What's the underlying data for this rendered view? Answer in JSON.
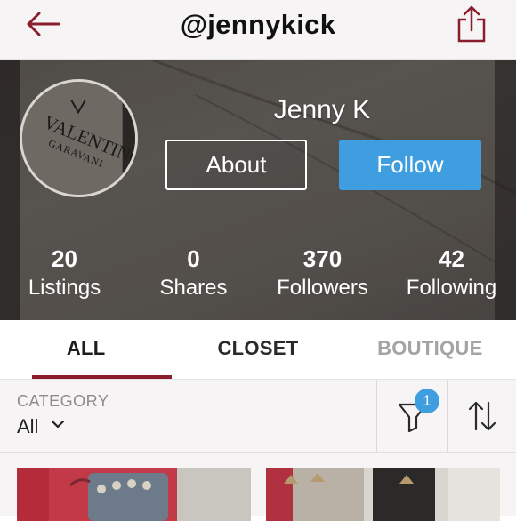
{
  "header": {
    "title": "@jennykick"
  },
  "avatar": {
    "brand_line1": "VALENTINO",
    "brand_line2": "GARAVANI"
  },
  "profile": {
    "name": "Jenny K",
    "about_label": "About",
    "follow_label": "Follow"
  },
  "stats": [
    {
      "value": "20",
      "label": "Listings"
    },
    {
      "value": "0",
      "label": "Shares"
    },
    {
      "value": "370",
      "label": "Followers"
    },
    {
      "value": "42",
      "label": "Following"
    }
  ],
  "tabs": [
    {
      "label": "ALL"
    },
    {
      "label": "CLOSET"
    },
    {
      "label": "BOUTIQUE"
    }
  ],
  "filter": {
    "category_label": "CATEGORY",
    "category_value": "All",
    "filter_count": "1"
  },
  "colors": {
    "brand": "#8a1e2c",
    "accent": "#3f9ee0"
  },
  "icons": [
    "back-arrow-icon",
    "share-icon",
    "chevron-down-icon",
    "filter-funnel-icon",
    "sort-arrows-icon"
  ]
}
